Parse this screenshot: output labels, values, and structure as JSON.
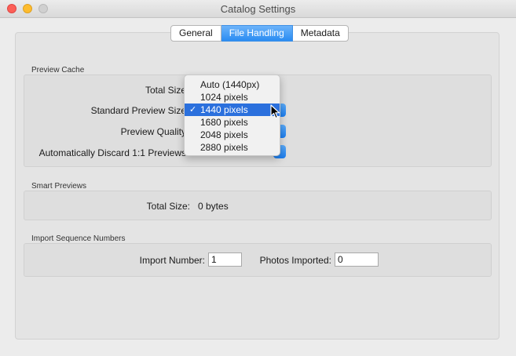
{
  "window": {
    "title": "Catalog Settings"
  },
  "tabs": [
    {
      "label": "General"
    },
    {
      "label": "File Handling",
      "active": true
    },
    {
      "label": "Metadata"
    }
  ],
  "preview_cache": {
    "section_label": "Preview Cache",
    "total_size_label": "Total Size",
    "standard_preview_size_label": "Standard Preview Size",
    "preview_quality_label": "Preview Quality",
    "discard_label": "Automatically Discard 1:1 Previews"
  },
  "dropdown": {
    "options": [
      {
        "label": "Auto (1440px)"
      },
      {
        "label": "1024 pixels"
      },
      {
        "label": "1440 pixels",
        "selected": true
      },
      {
        "label": "1680 pixels"
      },
      {
        "label": "2048 pixels"
      },
      {
        "label": "2880 pixels"
      }
    ],
    "check_glyph": "✓"
  },
  "smart_previews": {
    "section_label": "Smart Previews",
    "total_size_label": "Total Size:",
    "total_size_value": "0 bytes"
  },
  "import_sequence": {
    "section_label": "Import Sequence Numbers",
    "import_number_label": "Import Number:",
    "import_number_value": "1",
    "photos_imported_label": "Photos Imported:",
    "photos_imported_value": "0"
  },
  "colors": {
    "accent": "#2a8cf2",
    "selection": "#2b70dd",
    "close": "#fc5f57",
    "minimize": "#fdbc2e"
  },
  "icons": [
    "close-icon",
    "minimize-icon",
    "zoom-icon",
    "checkmark-icon",
    "mouse-cursor-icon"
  ]
}
